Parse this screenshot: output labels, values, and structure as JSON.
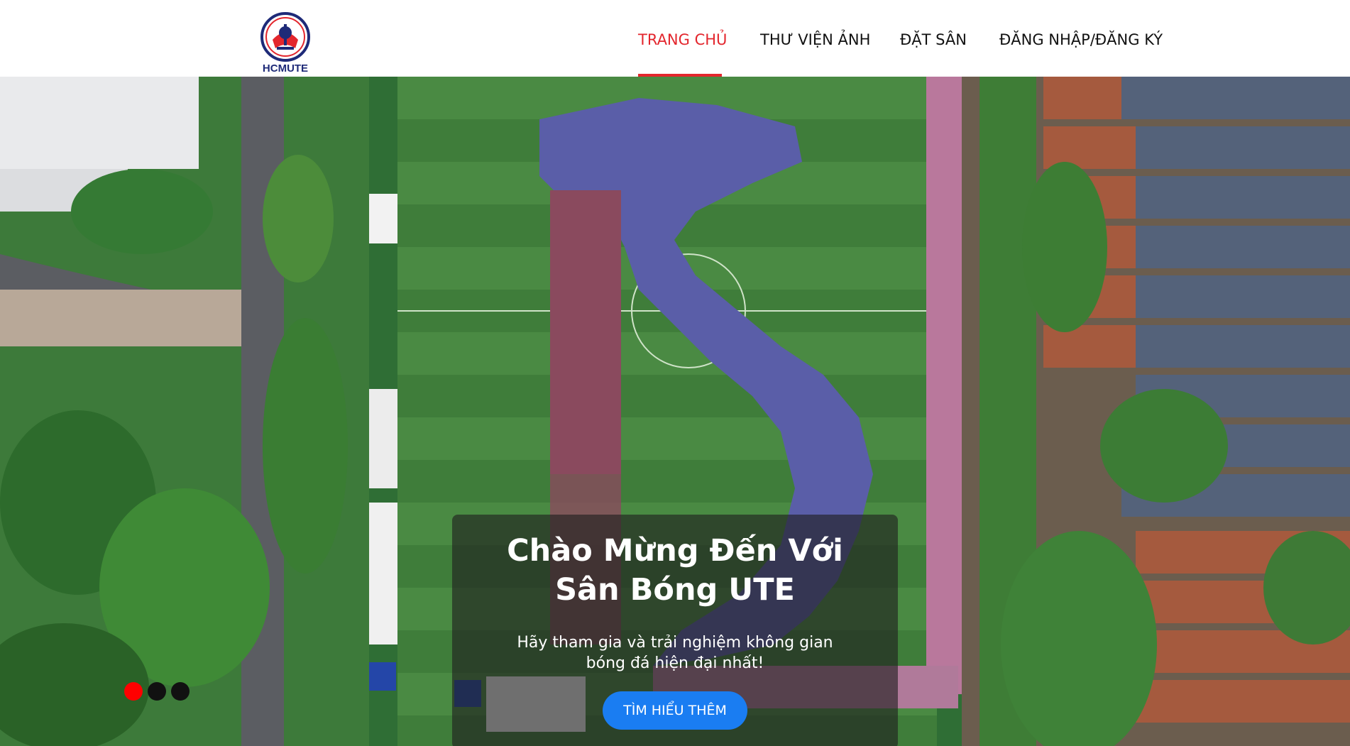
{
  "header": {
    "logo_text": "HCMUTE",
    "nav": [
      {
        "label": "TRANG CHỦ",
        "active": true
      },
      {
        "label": "THƯ VIỆN ẢNH",
        "active": false
      },
      {
        "label": "ĐẶT SÂN",
        "active": false
      },
      {
        "label": "ĐĂNG NHẬP/ĐĂNG KÝ",
        "active": false
      }
    ]
  },
  "hero": {
    "title": "Chào Mừng Đến Với Sân Bóng UTE",
    "subtitle": "Hãy tham gia và trải nghiệm không gian bóng đá hiện đại nhất!",
    "cta_label": "TÌM HIỂU THÊM",
    "slides_total": 3,
    "slide_active": 1
  },
  "colors": {
    "accent": "#e3262d",
    "button": "#1a7df2",
    "active_dot": "#ff0000"
  }
}
